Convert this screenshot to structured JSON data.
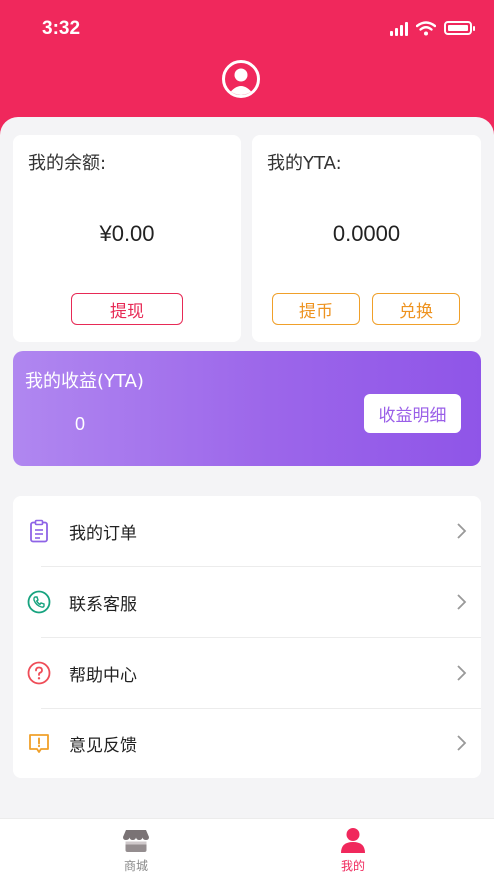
{
  "status_bar": {
    "time": "3:32"
  },
  "balance_card": {
    "title": "我的余额:",
    "value": "¥0.00",
    "withdraw_label": "提现"
  },
  "yta_card": {
    "title": "我的YTA:",
    "value": "0.0000",
    "withdraw_coin_label": "提币",
    "exchange_label": "兑换"
  },
  "earnings": {
    "title": "我的收益(YTA)",
    "value": "0",
    "details_label": "收益明细"
  },
  "menu": {
    "items": [
      {
        "label": "我的订单",
        "icon": "clipboard-icon"
      },
      {
        "label": "联系客服",
        "icon": "phone-icon"
      },
      {
        "label": "帮助中心",
        "icon": "question-icon"
      },
      {
        "label": "意见反馈",
        "icon": "feedback-icon"
      }
    ]
  },
  "tabbar": {
    "tabs": [
      {
        "label": "商城",
        "icon": "shop-icon"
      },
      {
        "label": "我的",
        "icon": "person-icon",
        "active": true
      }
    ]
  },
  "colors": {
    "accent": "#f0285c",
    "purple": "#9c66ea",
    "orange": "#f0a02a"
  }
}
